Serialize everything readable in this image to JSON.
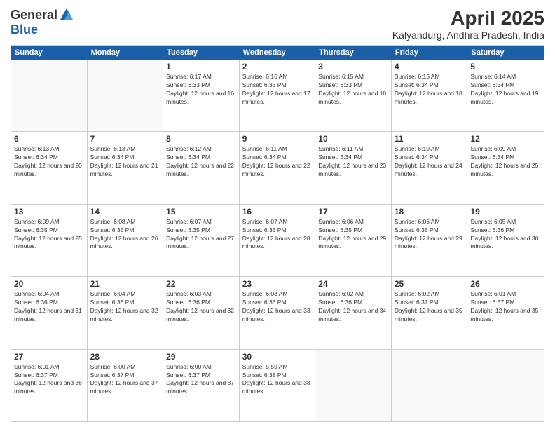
{
  "logo": {
    "general": "General",
    "blue": "Blue"
  },
  "header": {
    "title": "April 2025",
    "subtitle": "Kalyandurg, Andhra Pradesh, India"
  },
  "weekdays": [
    "Sunday",
    "Monday",
    "Tuesday",
    "Wednesday",
    "Thursday",
    "Friday",
    "Saturday"
  ],
  "rows": [
    [
      {
        "day": "",
        "sunrise": "",
        "sunset": "",
        "daylight": ""
      },
      {
        "day": "",
        "sunrise": "",
        "sunset": "",
        "daylight": ""
      },
      {
        "day": "1",
        "sunrise": "Sunrise: 6:17 AM",
        "sunset": "Sunset: 6:33 PM",
        "daylight": "Daylight: 12 hours and 16 minutes."
      },
      {
        "day": "2",
        "sunrise": "Sunrise: 6:16 AM",
        "sunset": "Sunset: 6:33 PM",
        "daylight": "Daylight: 12 hours and 17 minutes."
      },
      {
        "day": "3",
        "sunrise": "Sunrise: 6:15 AM",
        "sunset": "Sunset: 6:33 PM",
        "daylight": "Daylight: 12 hours and 18 minutes."
      },
      {
        "day": "4",
        "sunrise": "Sunrise: 6:15 AM",
        "sunset": "Sunset: 6:34 PM",
        "daylight": "Daylight: 12 hours and 18 minutes."
      },
      {
        "day": "5",
        "sunrise": "Sunrise: 6:14 AM",
        "sunset": "Sunset: 6:34 PM",
        "daylight": "Daylight: 12 hours and 19 minutes."
      }
    ],
    [
      {
        "day": "6",
        "sunrise": "Sunrise: 6:13 AM",
        "sunset": "Sunset: 6:34 PM",
        "daylight": "Daylight: 12 hours and 20 minutes."
      },
      {
        "day": "7",
        "sunrise": "Sunrise: 6:13 AM",
        "sunset": "Sunset: 6:34 PM",
        "daylight": "Daylight: 12 hours and 21 minutes."
      },
      {
        "day": "8",
        "sunrise": "Sunrise: 6:12 AM",
        "sunset": "Sunset: 6:34 PM",
        "daylight": "Daylight: 12 hours and 22 minutes."
      },
      {
        "day": "9",
        "sunrise": "Sunrise: 6:11 AM",
        "sunset": "Sunset: 6:34 PM",
        "daylight": "Daylight: 12 hours and 22 minutes."
      },
      {
        "day": "10",
        "sunrise": "Sunrise: 6:11 AM",
        "sunset": "Sunset: 6:34 PM",
        "daylight": "Daylight: 12 hours and 23 minutes."
      },
      {
        "day": "11",
        "sunrise": "Sunrise: 6:10 AM",
        "sunset": "Sunset: 6:34 PM",
        "daylight": "Daylight: 12 hours and 24 minutes."
      },
      {
        "day": "12",
        "sunrise": "Sunrise: 6:09 AM",
        "sunset": "Sunset: 6:34 PM",
        "daylight": "Daylight: 12 hours and 25 minutes."
      }
    ],
    [
      {
        "day": "13",
        "sunrise": "Sunrise: 6:09 AM",
        "sunset": "Sunset: 6:35 PM",
        "daylight": "Daylight: 12 hours and 25 minutes."
      },
      {
        "day": "14",
        "sunrise": "Sunrise: 6:08 AM",
        "sunset": "Sunset: 6:35 PM",
        "daylight": "Daylight: 12 hours and 26 minutes."
      },
      {
        "day": "15",
        "sunrise": "Sunrise: 6:07 AM",
        "sunset": "Sunset: 6:35 PM",
        "daylight": "Daylight: 12 hours and 27 minutes."
      },
      {
        "day": "16",
        "sunrise": "Sunrise: 6:07 AM",
        "sunset": "Sunset: 6:35 PM",
        "daylight": "Daylight: 12 hours and 28 minutes."
      },
      {
        "day": "17",
        "sunrise": "Sunrise: 6:06 AM",
        "sunset": "Sunset: 6:35 PM",
        "daylight": "Daylight: 12 hours and 29 minutes."
      },
      {
        "day": "18",
        "sunrise": "Sunrise: 6:06 AM",
        "sunset": "Sunset: 6:35 PM",
        "daylight": "Daylight: 12 hours and 29 minutes."
      },
      {
        "day": "19",
        "sunrise": "Sunrise: 6:05 AM",
        "sunset": "Sunset: 6:36 PM",
        "daylight": "Daylight: 12 hours and 30 minutes."
      }
    ],
    [
      {
        "day": "20",
        "sunrise": "Sunrise: 6:04 AM",
        "sunset": "Sunset: 6:36 PM",
        "daylight": "Daylight: 12 hours and 31 minutes."
      },
      {
        "day": "21",
        "sunrise": "Sunrise: 6:04 AM",
        "sunset": "Sunset: 6:36 PM",
        "daylight": "Daylight: 12 hours and 32 minutes."
      },
      {
        "day": "22",
        "sunrise": "Sunrise: 6:03 AM",
        "sunset": "Sunset: 6:36 PM",
        "daylight": "Daylight: 12 hours and 32 minutes."
      },
      {
        "day": "23",
        "sunrise": "Sunrise: 6:03 AM",
        "sunset": "Sunset: 6:36 PM",
        "daylight": "Daylight: 12 hours and 33 minutes."
      },
      {
        "day": "24",
        "sunrise": "Sunrise: 6:02 AM",
        "sunset": "Sunset: 6:36 PM",
        "daylight": "Daylight: 12 hours and 34 minutes."
      },
      {
        "day": "25",
        "sunrise": "Sunrise: 6:02 AM",
        "sunset": "Sunset: 6:37 PM",
        "daylight": "Daylight: 12 hours and 35 minutes."
      },
      {
        "day": "26",
        "sunrise": "Sunrise: 6:01 AM",
        "sunset": "Sunset: 6:37 PM",
        "daylight": "Daylight: 12 hours and 35 minutes."
      }
    ],
    [
      {
        "day": "27",
        "sunrise": "Sunrise: 6:01 AM",
        "sunset": "Sunset: 6:37 PM",
        "daylight": "Daylight: 12 hours and 36 minutes."
      },
      {
        "day": "28",
        "sunrise": "Sunrise: 6:00 AM",
        "sunset": "Sunset: 6:37 PM",
        "daylight": "Daylight: 12 hours and 37 minutes."
      },
      {
        "day": "29",
        "sunrise": "Sunrise: 6:00 AM",
        "sunset": "Sunset: 6:37 PM",
        "daylight": "Daylight: 12 hours and 37 minutes."
      },
      {
        "day": "30",
        "sunrise": "Sunrise: 5:59 AM",
        "sunset": "Sunset: 6:38 PM",
        "daylight": "Daylight: 12 hours and 38 minutes."
      },
      {
        "day": "",
        "sunrise": "",
        "sunset": "",
        "daylight": ""
      },
      {
        "day": "",
        "sunrise": "",
        "sunset": "",
        "daylight": ""
      },
      {
        "day": "",
        "sunrise": "",
        "sunset": "",
        "daylight": ""
      }
    ]
  ]
}
